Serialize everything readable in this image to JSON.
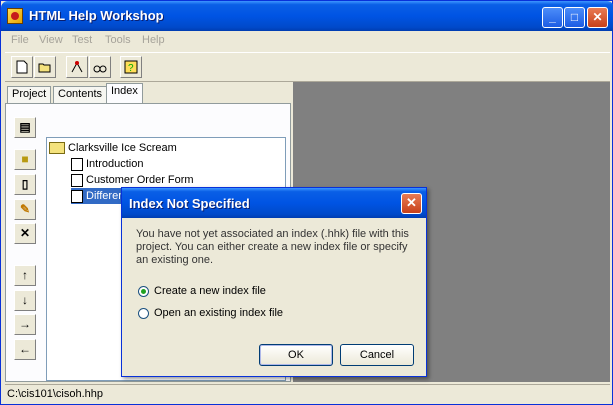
{
  "window": {
    "title": "HTML Help Workshop"
  },
  "menu": [
    "File",
    "View",
    "Test",
    "Tools",
    "Help"
  ],
  "toolbar": {
    "icons": [
      "new-icon",
      "open-icon",
      "compile-icon",
      "view-compiled-icon",
      "help-icon"
    ]
  },
  "tabs": [
    "Project",
    "Contents",
    "Index"
  ],
  "active_tab": "Index",
  "side_buttons": [
    "properties-icon",
    "insert-keyword-icon",
    "insert-page-icon",
    "edit-icon",
    "delete-icon",
    "move-up-icon",
    "move-down-icon",
    "move-right-icon",
    "move-left-icon"
  ],
  "tree": {
    "root": "Clarksville Ice Scream",
    "children": [
      "Introduction",
      "Customer Order Form",
      "Difference Calculation"
    ],
    "selected": "Difference Calculation"
  },
  "status": {
    "path": "C:\\cis101\\cisoh.hhp"
  },
  "dialog": {
    "title": "Index Not Specified",
    "message": "You have not yet associated an index (.hhk) file with this project. You can either create a new index file or specify an existing one.",
    "options": [
      "Create a new index file",
      "Open an existing index file"
    ],
    "selected_option": "Create a new index file",
    "ok_label": "OK",
    "cancel_label": "Cancel"
  }
}
